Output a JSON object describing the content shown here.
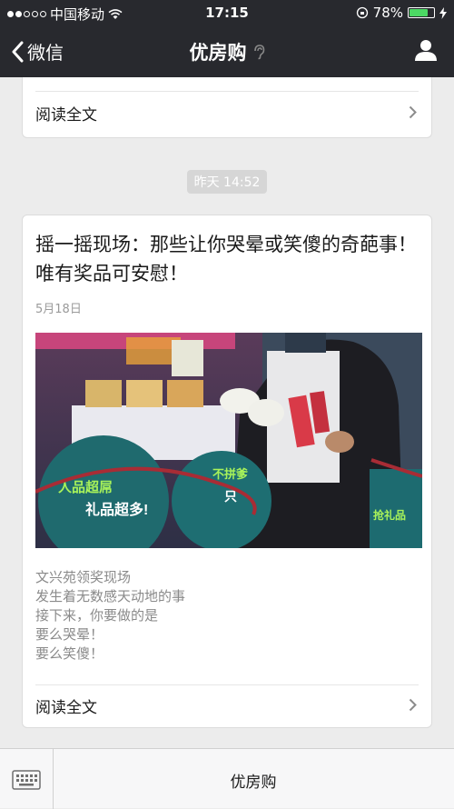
{
  "status_bar": {
    "carrier": "中国移动",
    "time": "17:15",
    "battery": "78%",
    "battery_level": 0.78
  },
  "nav": {
    "back_label": "微信",
    "title": "优房购"
  },
  "messages": {
    "previous": {
      "read_more": "阅读全文"
    },
    "timestamp": "昨天 14:52",
    "article": {
      "title": "摇一摇现场：那些让你哭晕或笑傻的奇葩事！唯有奖品可安慰！",
      "date": "5月18日",
      "excerpt": [
        "文兴苑领奖现场",
        "发生着无数感天动地的事",
        "接下来，你要做的是",
        "要么哭晕！",
        "要么笑傻！"
      ],
      "read_more": "阅读全文",
      "photo_text": {
        "sign_main": "人品超屌",
        "sign_sub": "礼品超多!",
        "sign_right": "不拼爹",
        "sign_right2": "只",
        "sign_far_right": "抢礼品"
      }
    }
  },
  "bottom_bar": {
    "menu_label": "优房购"
  },
  "colors": {
    "nav_bg": "#28292e",
    "page_bg": "#ececec",
    "battery_fill": "#4cd964"
  }
}
